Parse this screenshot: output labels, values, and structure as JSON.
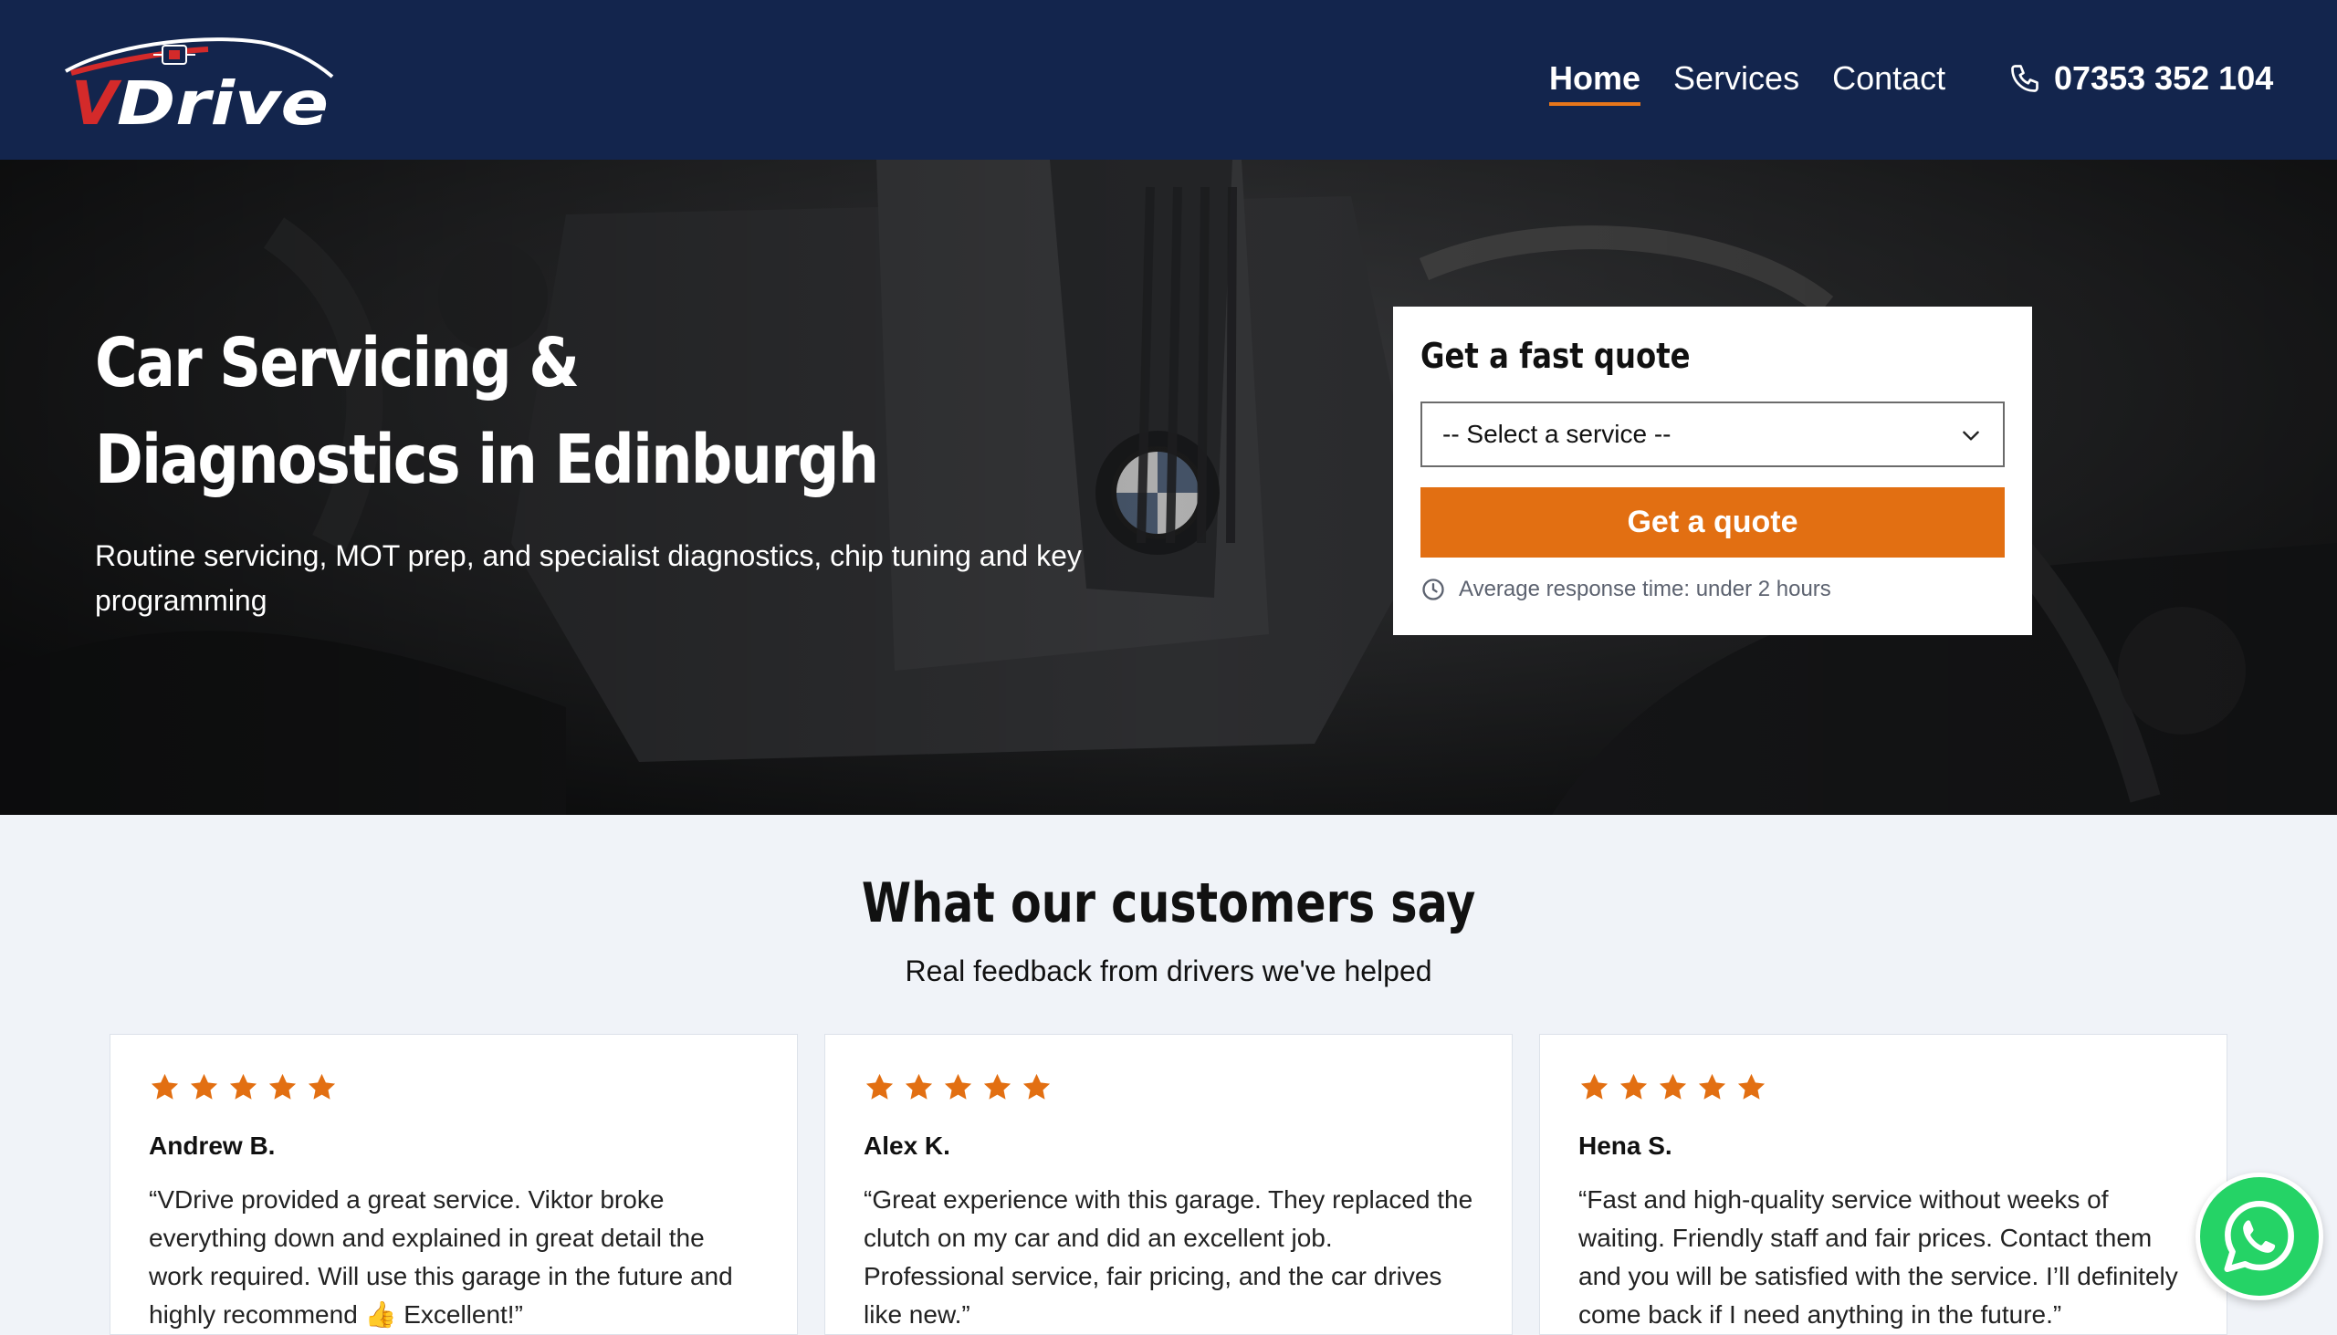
{
  "brand": {
    "name": "VDrive",
    "accent": "#e8761a",
    "primary": "#13254d",
    "logo_red": "#d42a2a"
  },
  "nav": {
    "items": [
      {
        "label": "Home",
        "active": true
      },
      {
        "label": "Services",
        "active": false
      },
      {
        "label": "Contact",
        "active": false
      }
    ],
    "phone": "07353 352 104",
    "phone_icon": "phone-icon"
  },
  "hero": {
    "title": "Car Servicing & Diagnostics in Edinburgh",
    "subtitle": "Routine servicing, MOT prep, and specialist diagnostics, chip tuning and key programming",
    "background": "engine-bay-photo"
  },
  "quote_form": {
    "title": "Get a fast quote",
    "select_value": "-- Select a service --",
    "button_label": "Get a quote",
    "response_note": "Average response time: under 2 hours",
    "response_icon": "clock-icon"
  },
  "testimonials": {
    "title": "What our customers say",
    "subtitle": "Real feedback from drivers we've helped",
    "star_color": "#e26f12",
    "reviews": [
      {
        "rating": 5,
        "name": "Andrew B.",
        "text": "“VDrive provided a great service. Viktor broke everything down and explained in great detail the work required. Will use this garage in the future and highly recommend 👍 Excellent!”"
      },
      {
        "rating": 5,
        "name": "Alex K.",
        "text": "“Great experience with this garage. They replaced the clutch on my car and did an excellent job. Professional service, fair pricing, and the car drives like new.”"
      },
      {
        "rating": 5,
        "name": "Hena S.",
        "text": "“Fast and high-quality service without weeks of waiting. Friendly staff and fair prices. Contact them and you will be satisfied with the service. I’ll definitely come back if I need anything in the future.”"
      }
    ]
  },
  "whatsapp": {
    "icon": "whatsapp-icon",
    "color": "#25d366"
  }
}
